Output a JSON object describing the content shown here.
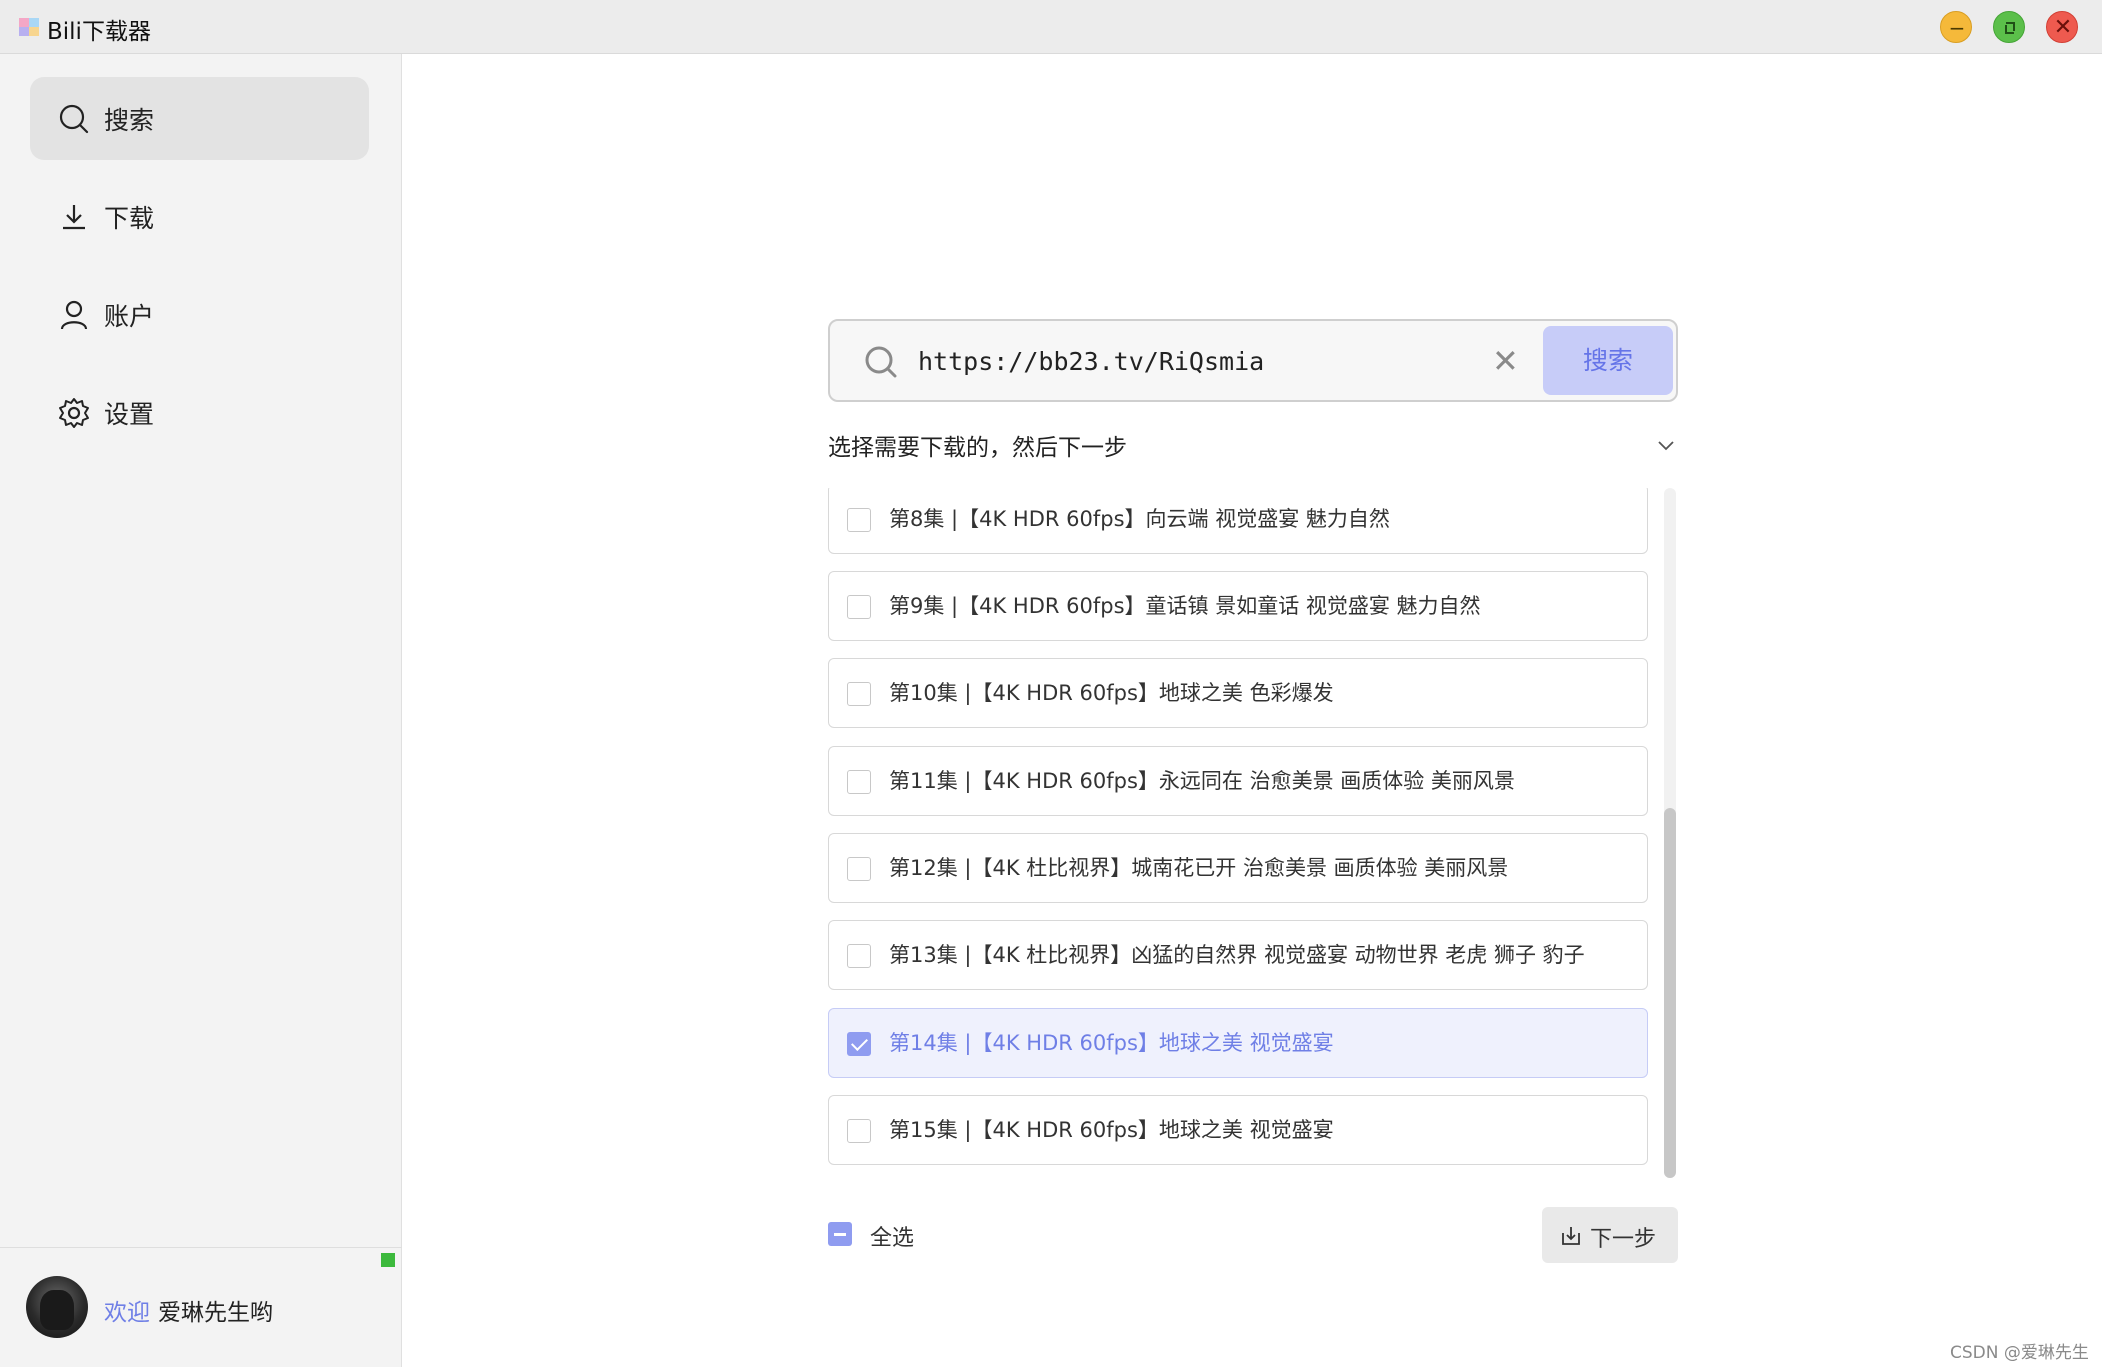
{
  "window": {
    "title": "Bili下载器"
  },
  "sidebar": {
    "items": [
      {
        "label": "搜索",
        "icon": "search-icon",
        "active": true
      },
      {
        "label": "下载",
        "icon": "download-icon",
        "active": false
      },
      {
        "label": "账户",
        "icon": "user-icon",
        "active": false
      },
      {
        "label": "设置",
        "icon": "gear-icon",
        "active": false
      }
    ],
    "welcome": "欢迎",
    "username": "爱琳先生哟",
    "status_color": "#3cb93c"
  },
  "search": {
    "value": "https://bb23.tv/RiQsmia",
    "button_label": "搜索"
  },
  "list": {
    "hint": "选择需要下载的，然后下一步",
    "episodes": [
      {
        "label": "第8集 |【4K HDR 60fps】向云端 视觉盛宴 魅力自然",
        "checked": false
      },
      {
        "label": "第9集 |【4K HDR 60fps】童话镇 景如童话 视觉盛宴 魅力自然",
        "checked": false
      },
      {
        "label": "第10集 |【4K HDR 60fps】地球之美 色彩爆发",
        "checked": false
      },
      {
        "label": "第11集 |【4K HDR 60fps】永远同在 治愈美景 画质体验 美丽风景",
        "checked": false
      },
      {
        "label": "第12集 |【4K 杜比视界】城南花已开 治愈美景 画质体验 美丽风景",
        "checked": false
      },
      {
        "label": "第13集 |【4K 杜比视界】凶猛的自然界 视觉盛宴 动物世界 老虎 狮子 豹子",
        "checked": false
      },
      {
        "label": "第14集 |【4K HDR 60fps】地球之美 视觉盛宴",
        "checked": true
      },
      {
        "label": "第15集 |【4K HDR 60fps】地球之美 视觉盛宴",
        "checked": false
      }
    ]
  },
  "footer": {
    "select_all": "全选",
    "next_label": "下一步"
  },
  "watermark": "CSDN @爱琳先生",
  "colors": {
    "accent": "#6f7fe6",
    "accent_light": "#c7ccf8",
    "selected_bg": "#eff1fd"
  }
}
